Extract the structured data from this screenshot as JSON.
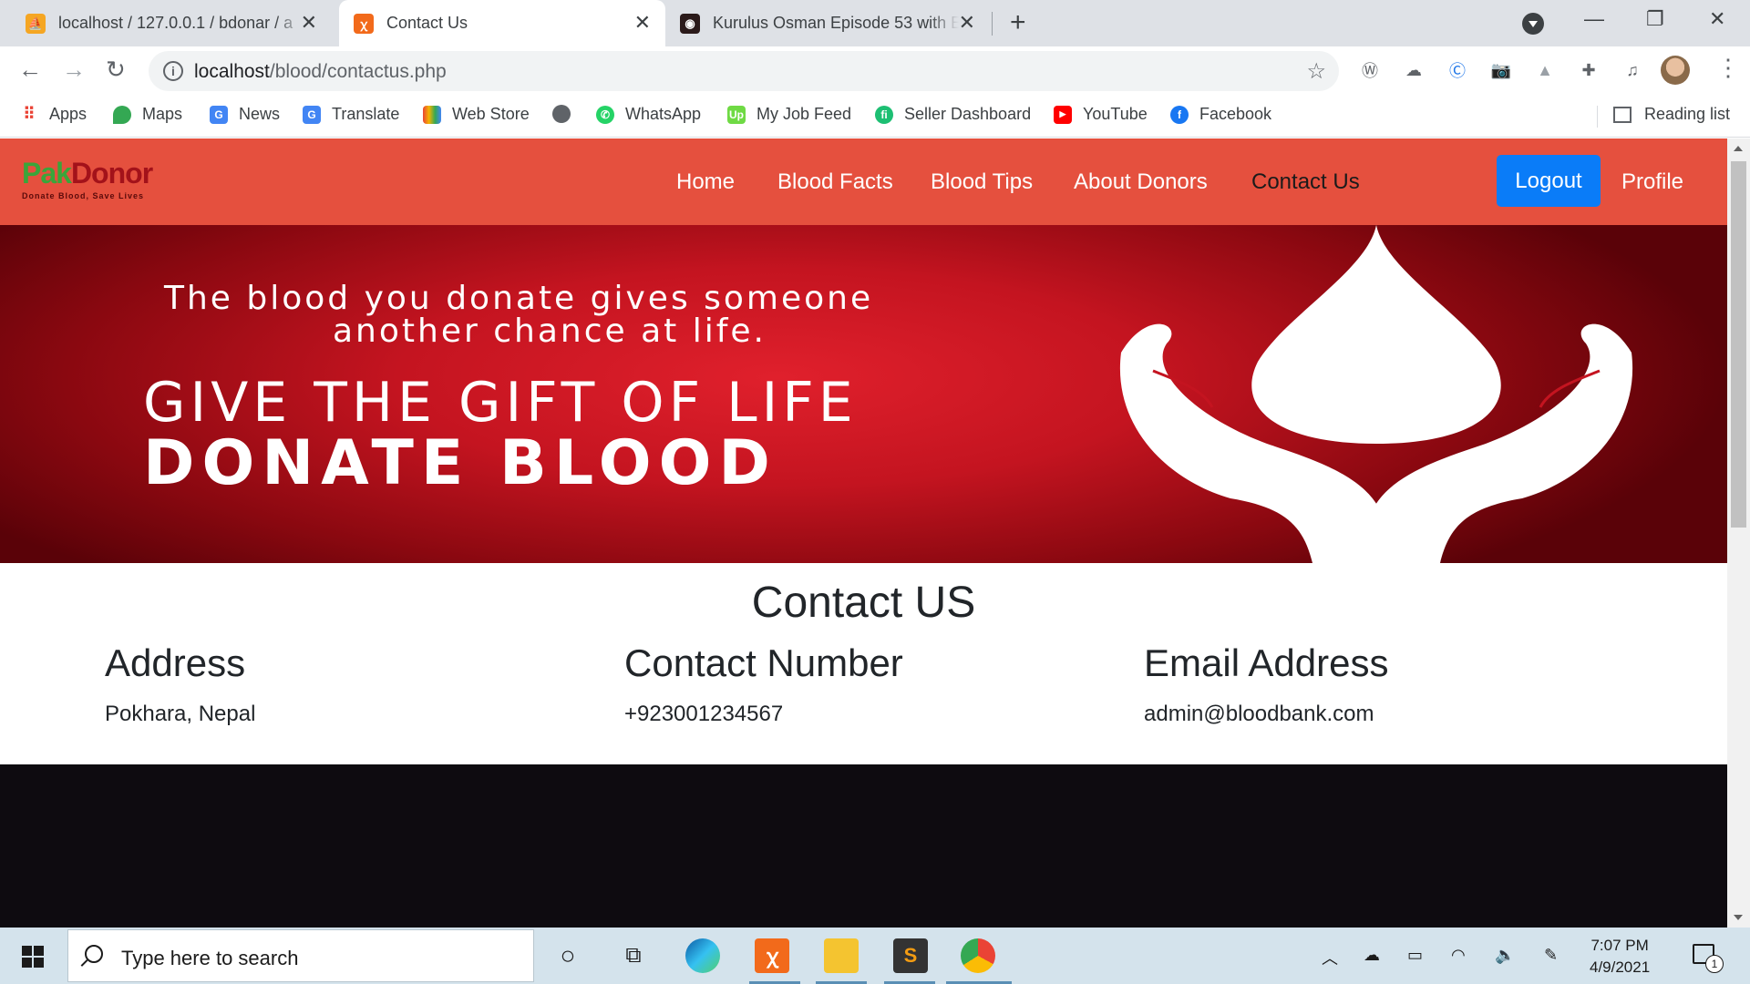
{
  "browser": {
    "tabs": [
      {
        "title": "localhost / 127.0.0.1 / bdonar / a",
        "favicon": "phpmyadmin-icon"
      },
      {
        "title": "Contact Us",
        "favicon": "xampp-icon",
        "active": true
      },
      {
        "title": "Kurulus Osman Episode 53 with E",
        "favicon": "video-site-icon"
      }
    ],
    "url_host": "localhost",
    "url_path": "/blood/contactus.php",
    "bookmarks": [
      {
        "label": "Apps",
        "icon": "apps-grid-icon",
        "color": "#ea4335"
      },
      {
        "label": "Maps",
        "icon": "maps-pin-icon",
        "color": "#34a853"
      },
      {
        "label": "News",
        "icon": "news-icon",
        "color": "#4285f4"
      },
      {
        "label": "Translate",
        "icon": "translate-icon",
        "color": "#4285f4"
      },
      {
        "label": "Web Store",
        "icon": "web-store-icon",
        "color": "#f4b400"
      },
      {
        "label": "",
        "icon": "globe-icon",
        "color": "#5f6368"
      },
      {
        "label": "WhatsApp",
        "icon": "whatsapp-icon",
        "color": "#25d366"
      },
      {
        "label": "My Job Feed",
        "icon": "upwork-icon",
        "color": "#6fda44"
      },
      {
        "label": "Seller Dashboard",
        "icon": "fiverr-icon",
        "color": "#1dbf73"
      },
      {
        "label": "YouTube",
        "icon": "youtube-icon",
        "color": "#ff0000"
      },
      {
        "label": "Facebook",
        "icon": "facebook-icon",
        "color": "#1877f2"
      }
    ],
    "reading_list": "Reading list"
  },
  "site": {
    "logo_pak": "Pak",
    "logo_donor": "Donor",
    "logo_tagline": "Donate Blood, Save Lives",
    "nav": [
      "Home",
      "Blood Facts",
      "Blood Tips",
      "About Donors",
      "Contact Us"
    ],
    "active_nav": "Contact Us",
    "logout": "Logout",
    "profile": "Profile",
    "hero": {
      "line1": "The blood you donate gives someone",
      "line2": "another chance at life.",
      "big1": "GIVE THE GIFT OF LIFE",
      "big2": "DONATE BLOOD"
    },
    "contact": {
      "title": "Contact US",
      "address_heading": "Address",
      "address_value": "Pokhara, Nepal",
      "phone_heading": "Contact Number",
      "phone_value": "+923001234567",
      "email_heading": "Email Address",
      "email_value": "admin@bloodbank.com"
    },
    "colors": {
      "nav_bg": "#e5503e",
      "logout_bg": "#0a7cf8",
      "footer_bg": "#0e0b10"
    }
  },
  "taskbar": {
    "search_placeholder": "Type here to search",
    "time": "7:07 PM",
    "date": "4/9/2021",
    "notification_count": "1"
  }
}
